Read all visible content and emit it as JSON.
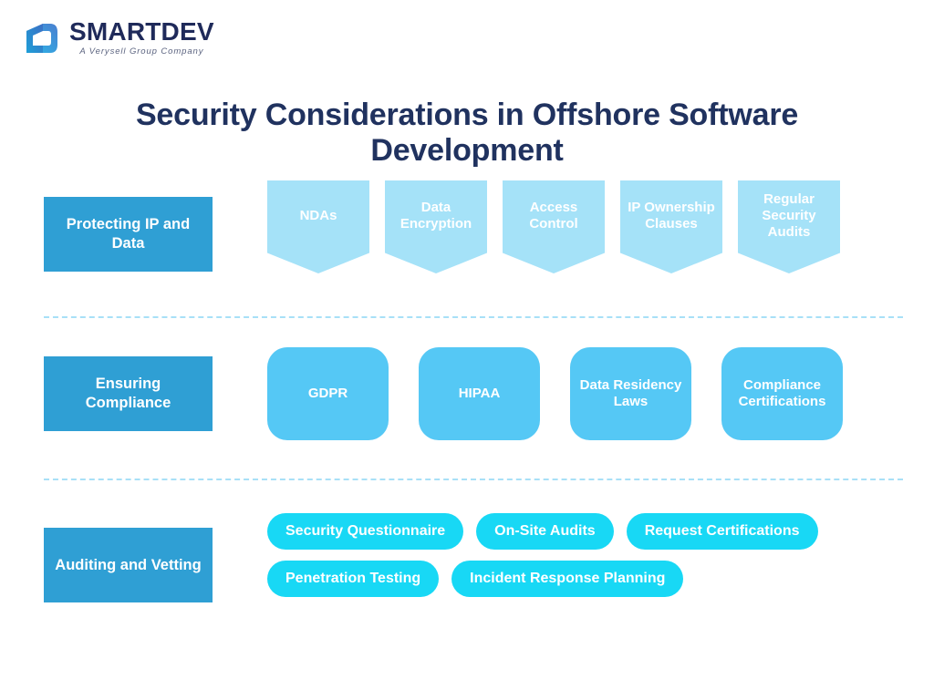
{
  "brand": {
    "name": "SMARTDEV",
    "tagline": "A Verysell Group Company",
    "logo_icon": "smartdev-d-mark",
    "logo_gradient_from": "#4a7fd0",
    "logo_gradient_to": "#2bb8e8",
    "wordmark_color": "#1f2a5a"
  },
  "title": "Security Considerations in Offshore Software Development",
  "colors": {
    "background": "#ffffff",
    "title_text": "#20325f",
    "category_box": "#2f9fd4",
    "row1_item": "#a5e2f8",
    "row2_item": "#55c8f5",
    "row3_item": "#18d8f5",
    "divider": "#a8e0f7",
    "item_text": "#ffffff"
  },
  "sections": [
    {
      "category": "Protecting IP and Data",
      "shape": "pentagon",
      "items": [
        "NDAs",
        "Data Encryption",
        "Access Control",
        "IP Ownership Clauses",
        "Regular Security Audits"
      ]
    },
    {
      "category": "Ensuring Compliance",
      "shape": "rounded-square",
      "items": [
        "GDPR",
        "HIPAA",
        "Data Residency Laws",
        "Compliance Certifications"
      ]
    },
    {
      "category": "Auditing and Vetting",
      "shape": "pill",
      "items": [
        "Security Questionnaire",
        "On-Site Audits",
        "Request Certifications",
        "Penetration Testing",
        "Incident Response Planning"
      ]
    }
  ]
}
